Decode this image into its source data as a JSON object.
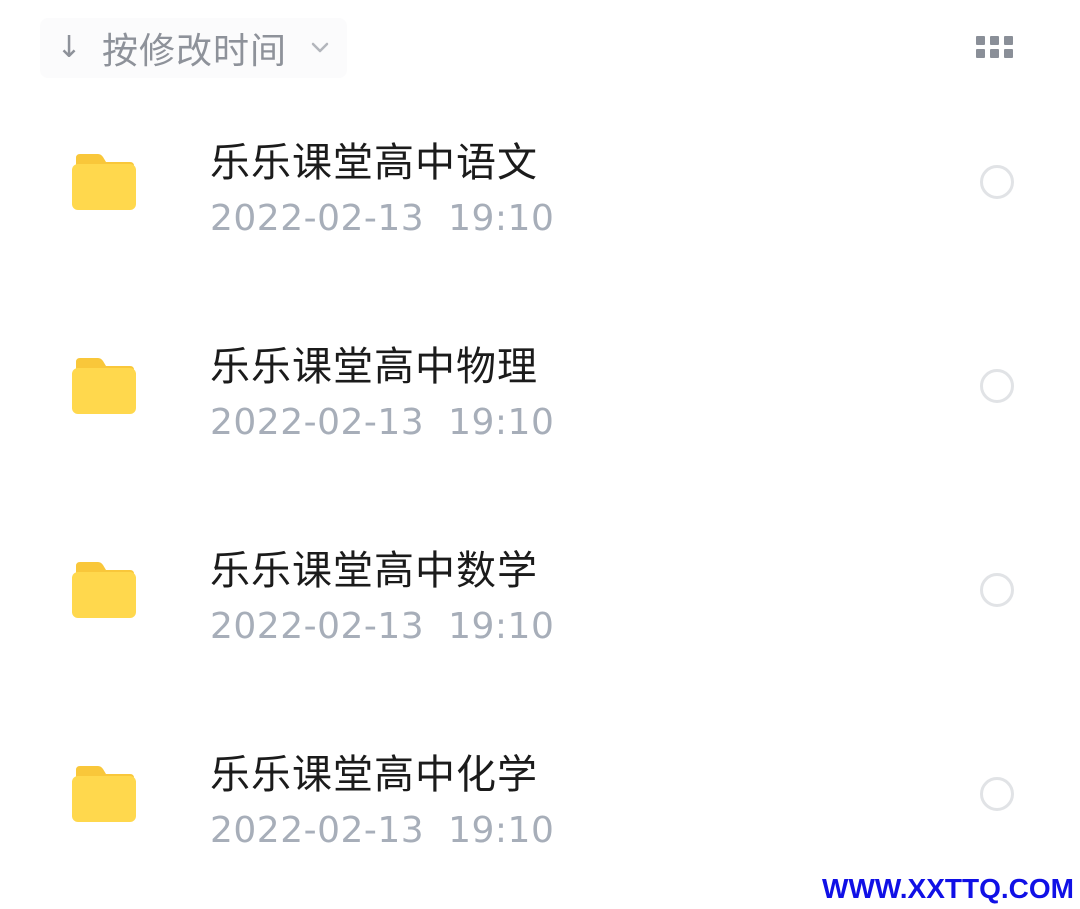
{
  "sort": {
    "arrow": "↓",
    "label": "按修改时间",
    "chevron_icon": "chevron-down-icon"
  },
  "view_toggle": {
    "icon": "grid-view-icon"
  },
  "folder_color": "#FFD84D",
  "folder_tab_color": "#F9C73A",
  "files": [
    {
      "name": "乐乐课堂高中语文",
      "modified": "2022-02-13  19:10"
    },
    {
      "name": "乐乐课堂高中物理",
      "modified": "2022-02-13  19:10"
    },
    {
      "name": "乐乐课堂高中数学",
      "modified": "2022-02-13  19:10"
    },
    {
      "name": "乐乐课堂高中化学",
      "modified": "2022-02-13  19:10"
    }
  ],
  "watermark": "WWW.XXTTQ.COM"
}
